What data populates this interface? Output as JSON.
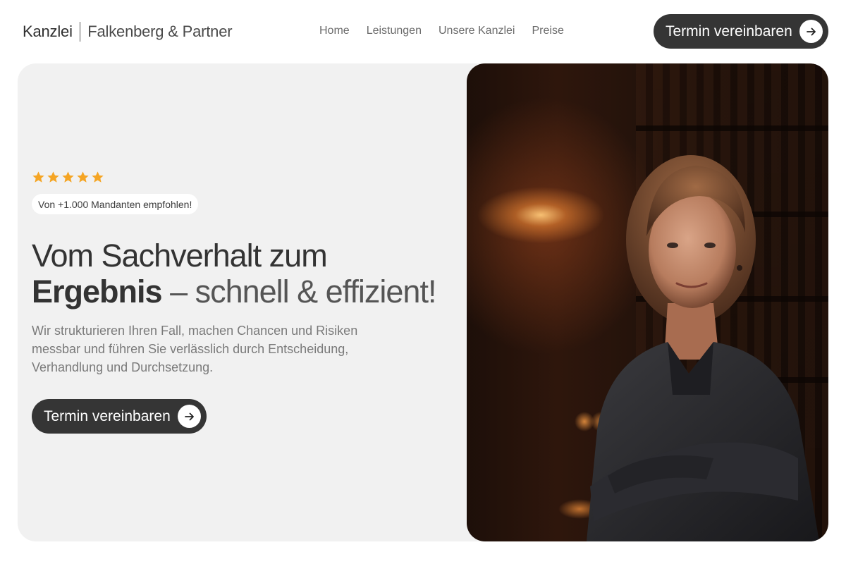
{
  "brand": {
    "name": "Kanzlei",
    "firm": "Falkenberg & Partner"
  },
  "nav": {
    "items": [
      "Home",
      "Leistungen",
      "Unsere Kanzlei",
      "Preise"
    ]
  },
  "header_cta": {
    "label": "Termin vereinbaren",
    "icon": "arrow-right-icon"
  },
  "hero": {
    "rating": {
      "stars": 5,
      "max": 5,
      "color": "#f5a524"
    },
    "badge": "Von +1.000 Mandanten empfohlen!",
    "headline_bold": "Vom Sachverhalt zum",
    "headline_bold2": "Ergebnis",
    "headline_light": "– schnell & effizient!",
    "subtext": "Wir strukturieren Ihren Fall, machen Chancen und Risiken messbar und führen Sie verlässlich durch Entscheidung, Verhandlung und Durchsetzung.",
    "cta": {
      "label": "Termin vereinbaren",
      "icon": "arrow-right-icon"
    }
  },
  "colors": {
    "dark_button": "#353535",
    "hero_bg": "#f1f1f1",
    "star": "#f5a524"
  }
}
